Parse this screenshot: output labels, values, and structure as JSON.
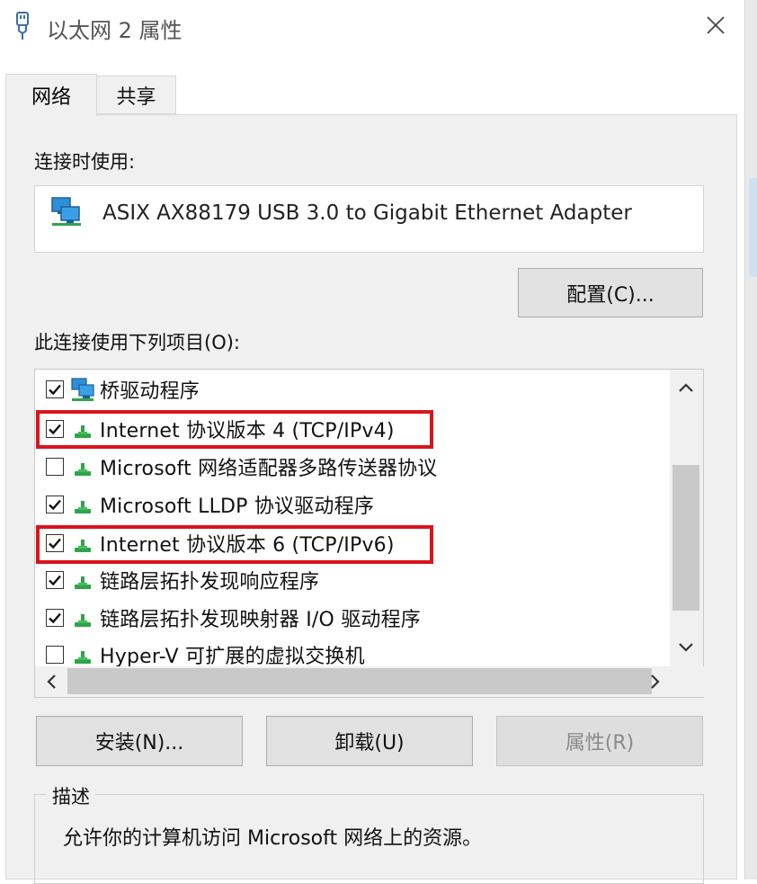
{
  "window": {
    "title": "以太网 2 属性",
    "icon": "network-adapter-icon",
    "close_icon": "close-icon"
  },
  "tabs": [
    {
      "label": "网络",
      "selected": true
    },
    {
      "label": "共享",
      "selected": false
    }
  ],
  "connection": {
    "label": "连接时使用:",
    "adapter_name": "ASIX AX88179 USB 3.0 to Gigabit Ethernet Adapter",
    "adapter_icon": "network-monitor-icon",
    "configure_button": "配置(C)..."
  },
  "items": {
    "label": "此连接使用下列项目(O):",
    "list": [
      {
        "label": "桥驱动程序",
        "checked": true,
        "icon": "bridge-monitor-icon"
      },
      {
        "label": "Internet 协议版本 4 (TCP/IPv4)",
        "checked": true,
        "icon": "protocol-icon",
        "highlighted": true
      },
      {
        "label": "Microsoft 网络适配器多路传送器协议",
        "checked": false,
        "icon": "protocol-icon"
      },
      {
        "label": "Microsoft LLDP 协议驱动程序",
        "checked": true,
        "icon": "protocol-icon"
      },
      {
        "label": "Internet 协议版本 6 (TCP/IPv6)",
        "checked": true,
        "icon": "protocol-icon",
        "highlighted": true
      },
      {
        "label": "链路层拓扑发现响应程序",
        "checked": true,
        "icon": "protocol-icon"
      },
      {
        "label": "链路层拓扑发现映射器 I/O 驱动程序",
        "checked": true,
        "icon": "protocol-icon"
      },
      {
        "label": "Hyper-V 可扩展的虚拟交换机",
        "checked": false,
        "icon": "protocol-icon"
      }
    ]
  },
  "buttons": {
    "install": "安装(N)...",
    "uninstall": "卸载(U)",
    "properties": "属性(R)",
    "properties_enabled": false
  },
  "description": {
    "title": "描述",
    "text": "允许你的计算机访问 Microsoft 网络上的资源。"
  },
  "colors": {
    "highlight": "#d9151c",
    "dialog_bg": "#f0f0f0",
    "button_bg": "#e1e1e1"
  }
}
